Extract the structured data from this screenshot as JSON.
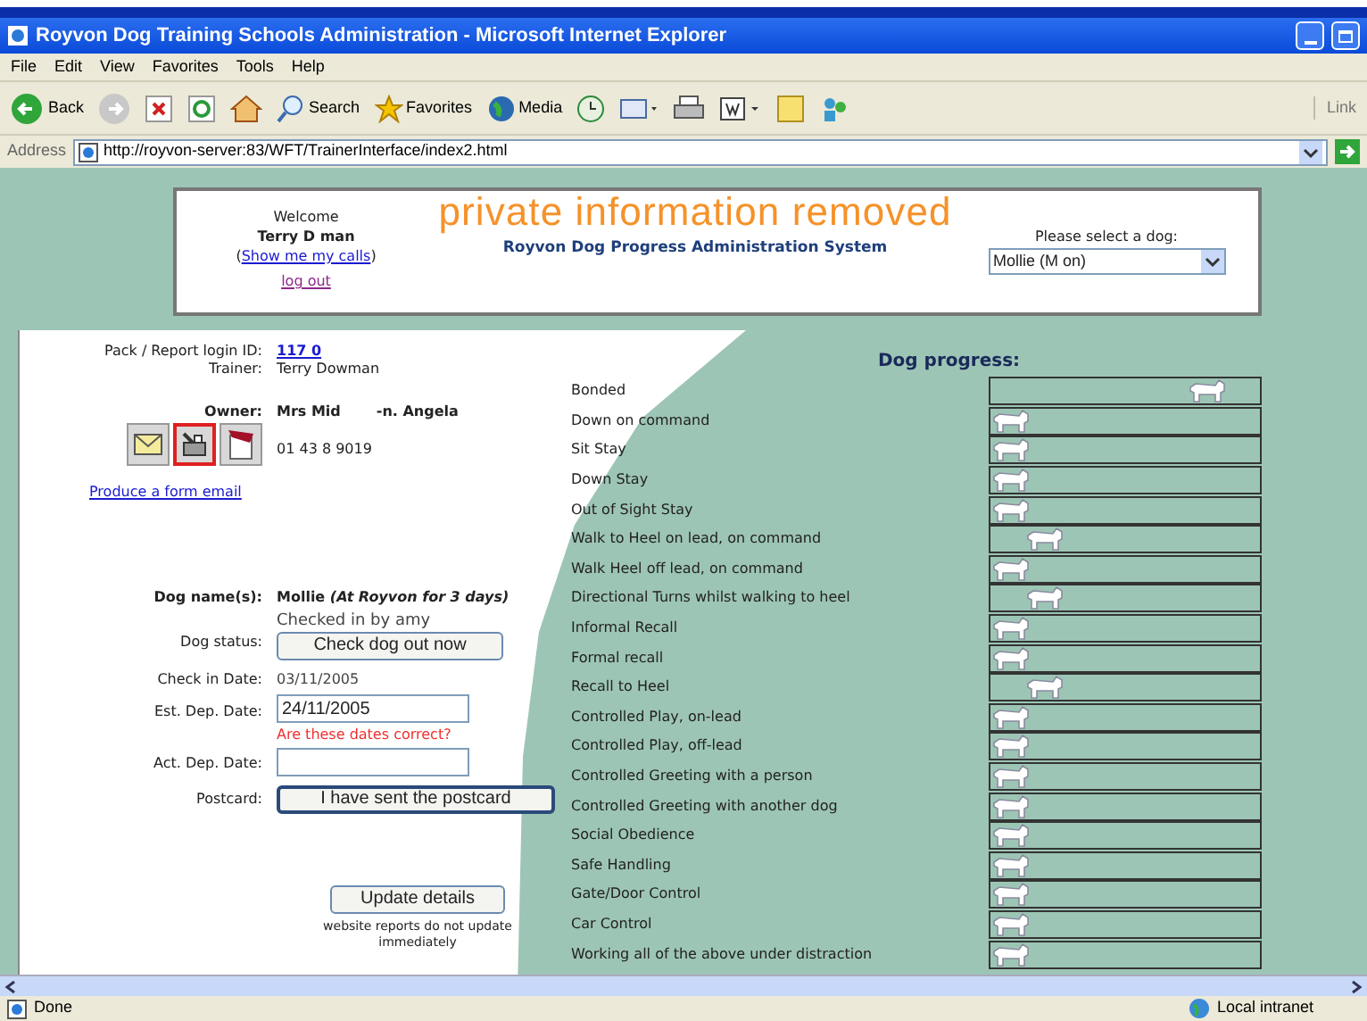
{
  "window": {
    "title": "Royvon Dog Training Schools Administration - Microsoft Internet Explorer"
  },
  "menu": [
    "File",
    "Edit",
    "View",
    "Favorites",
    "Tools",
    "Help"
  ],
  "toolbar": {
    "back": "Back",
    "search": "Search",
    "favorites": "Favorites",
    "media": "Media",
    "links": "Link"
  },
  "address": {
    "label": "Address",
    "url": "http://royvon-server:83/WFT/TrainerInterface/index2.html"
  },
  "header": {
    "welcome": "Welcome",
    "user": "Terry D man",
    "calls_prefix": "(",
    "calls_link": "Show me my calls",
    "calls_suffix": ")",
    "logout": "log out",
    "banner": "private information removed",
    "system_title": "Royvon Dog Progress Administration System",
    "dog_select": {
      "label": "Please select a dog:",
      "value": "Mollie (M on)"
    }
  },
  "details": [
    {
      "label": "Pack / Report login ID:",
      "kind": "link",
      "value": "117 0"
    },
    {
      "label": "Trainer:",
      "kind": "text",
      "value": "Terry Dowman"
    }
  ],
  "owner": {
    "label": "Owner:",
    "name_parts": [
      "Mrs Mid",
      "-n. Angela"
    ],
    "phone": "01 43 8 9019"
  },
  "contact_buttons": [
    {
      "kind": "envelope",
      "selected": false
    },
    {
      "kind": "fax",
      "selected": true
    },
    {
      "kind": "flag",
      "selected": false
    }
  ],
  "form_email_link": "Produce a form email",
  "dog": {
    "label": "Dog name(s):",
    "name": "Mollie *(At Royvon for 3 days)*"
  },
  "status": {
    "label": "Dog status:",
    "note": "Checked in by amy",
    "button": "Check dog out now"
  },
  "check_in": {
    "label": "Check in Date:",
    "value": "03/11/2005"
  },
  "est_dep": {
    "label": "Est. Dep. Date:",
    "value": "24/11/2005",
    "warning": "Are these dates correct?"
  },
  "act_dep": {
    "label": "Act. Dep. Date:"
  },
  "postcard": {
    "label": "Postcard:",
    "button": "I have sent the postcard"
  },
  "update": {
    "button": "Update details",
    "note": "website reports do not update immediately"
  },
  "progress": {
    "title": "Dog progress:",
    "items": [
      {
        "name": "Bonded",
        "level": 0.85
      },
      {
        "name": "Down on command",
        "level": 0
      },
      {
        "name": "Sit Stay",
        "level": 0
      },
      {
        "name": "Down Stay",
        "level": 0
      },
      {
        "name": "Out of Sight Stay",
        "level": 0
      },
      {
        "name": "Walk to Heel on lead, on command",
        "level": 0.15
      },
      {
        "name": "Walk Heel off lead, on command",
        "level": 0
      },
      {
        "name": "Directional Turns whilst walking to heel",
        "level": 0.15
      },
      {
        "name": "Informal Recall",
        "level": 0
      },
      {
        "name": "Formal recall",
        "level": 0
      },
      {
        "name": "Recall to Heel",
        "level": 0.15
      },
      {
        "name": "Controlled Play, on-lead",
        "level": 0
      },
      {
        "name": "Controlled Play, off-lead",
        "level": 0
      },
      {
        "name": "Controlled Greeting with a person",
        "level": 0
      },
      {
        "name": "Controlled Greeting with another dog",
        "level": 0
      },
      {
        "name": "Social Obedience",
        "level": 0
      },
      {
        "name": "Safe Handling",
        "level": 0
      },
      {
        "name": "Gate/Door Control",
        "level": 0
      },
      {
        "name": "Car Control",
        "level": 0
      },
      {
        "name": "Working all of the above under distraction",
        "level": 0
      }
    ]
  },
  "status_bar": {
    "text": "Done",
    "zone": "Local intranet"
  }
}
